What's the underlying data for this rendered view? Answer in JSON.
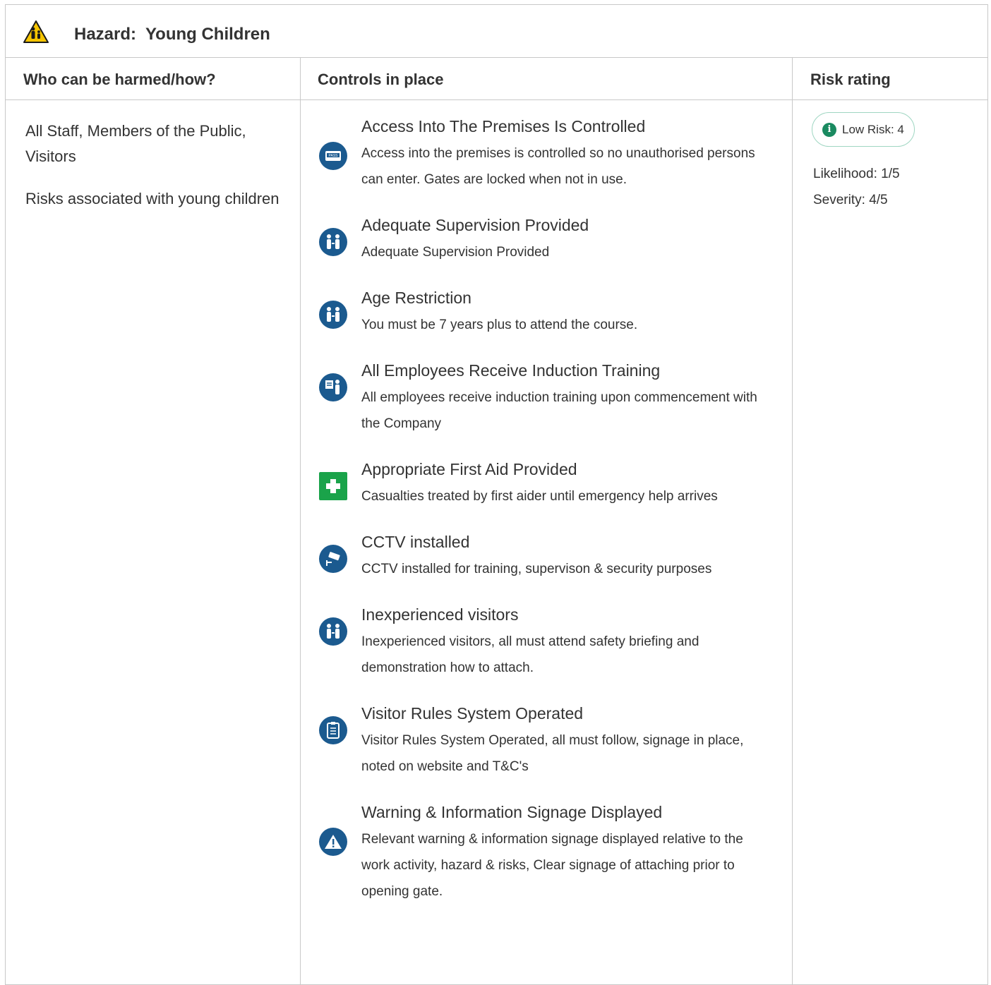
{
  "hazard": {
    "prefix": "Hazard:",
    "name": "Young Children",
    "icon": "warning-children-icon"
  },
  "columns": {
    "who": "Who can be harmed/how?",
    "controls": "Controls in place",
    "risk": "Risk rating"
  },
  "who": {
    "people": "All Staff, Members of the Public, Visitors",
    "risk_note": "Risks associated with young children"
  },
  "controls": [
    {
      "title": "Access Into The Premises Is Controlled",
      "desc": "Access into the premises is controlled so no unauthorised persons can enter. Gates are locked when not in use.",
      "icon": "pass-card-icon"
    },
    {
      "title": "Adequate Supervision Provided",
      "desc": "Adequate Supervision Provided",
      "icon": "people-icon"
    },
    {
      "title": "Age Restriction",
      "desc": "You must be 7 years plus to attend the course.",
      "icon": "people-icon"
    },
    {
      "title": "All Employees Receive Induction Training",
      "desc": "All employees receive induction training upon commencement with the Company",
      "icon": "training-icon"
    },
    {
      "title": "Appropriate First Aid Provided",
      "desc": "Casualties treated by first aider until emergency help arrives",
      "icon": "first-aid-icon"
    },
    {
      "title": "CCTV installed",
      "desc": "CCTV installed for training, supervison & security purposes",
      "icon": "cctv-icon"
    },
    {
      "title": "Inexperienced visitors",
      "desc": "Inexperienced visitors, all must attend safety briefing and demonstration how to attach.",
      "icon": "people-icon"
    },
    {
      "title": "Visitor Rules System Operated",
      "desc": "Visitor Rules System Operated, all must follow, signage in place, noted on website and T&C's",
      "icon": "clipboard-icon"
    },
    {
      "title": "Warning & Information Signage Displayed",
      "desc": "Relevant warning & information signage displayed relative to the work activity, hazard & risks, Clear signage of attaching prior to opening gate.",
      "icon": "warning-icon"
    }
  ],
  "risk": {
    "badge": "Low Risk: 4",
    "likelihood": "Likelihood: 1/5",
    "severity": "Severity: 4/5",
    "badge_color": "#1a8a60"
  }
}
